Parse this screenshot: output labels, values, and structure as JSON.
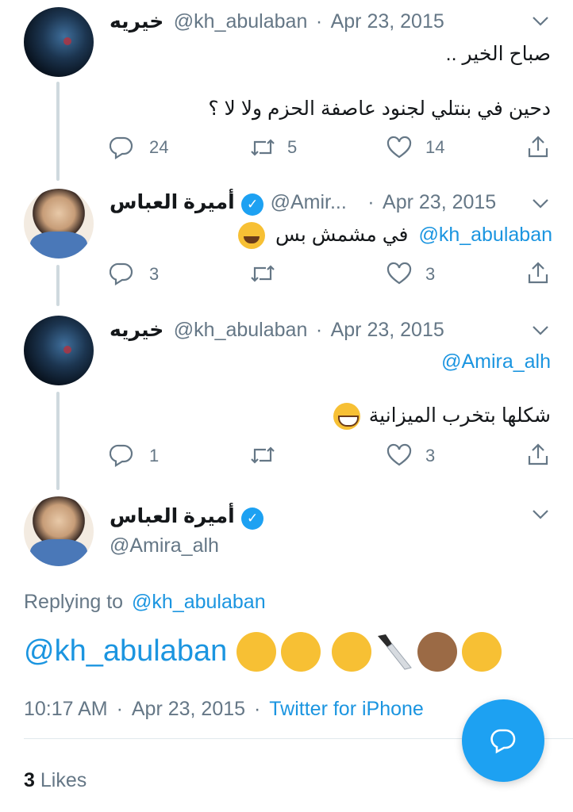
{
  "tweets": [
    {
      "name": "خيريه",
      "handle": "@kh_abulaban",
      "sep": "·",
      "date": "Apr 23, 2015",
      "line1": "صباح الخير ..",
      "line2": "دحين في بنتلي لجنود عاصفة الحزم ولا لا ؟",
      "replies": "24",
      "retweets": "5",
      "likes": "14"
    },
    {
      "name": "أميرة العباس",
      "handle": "@Amir...",
      "sep": "·",
      "date": "Apr 23, 2015",
      "mention": "@kh_abulaban",
      "text": "في مشمش بس",
      "replies": "3",
      "retweets": "",
      "likes": "3"
    },
    {
      "name": "خيريه",
      "handle": "@kh_abulaban",
      "sep": "·",
      "date": "Apr 23, 2015",
      "mention": "@Amira_alh",
      "text": "شكلها بتخرب الميزانية",
      "replies": "1",
      "retweets": "",
      "likes": "3"
    }
  ],
  "main_tweet": {
    "name": "أميرة العباس",
    "handle": "@Amira_alh",
    "replying_prefix": "Replying to",
    "replying_to": "@kh_abulaban",
    "mention": "@kh_abulaban",
    "time": "10:17 AM",
    "sep": "·",
    "date": "Apr 23, 2015",
    "source": "Twitter for iPhone",
    "likes_count": "3",
    "likes_label": "Likes"
  },
  "icons": {
    "reply": "reply-icon",
    "retweet": "retweet-icon",
    "like": "heart-icon",
    "share": "share-icon",
    "verified": "verified-badge-icon",
    "chevron": "chevron-down-icon",
    "compose": "compose-reply-icon"
  },
  "colors": {
    "link": "#1b95e0",
    "muted": "#657786",
    "accent": "#1da1f2"
  }
}
